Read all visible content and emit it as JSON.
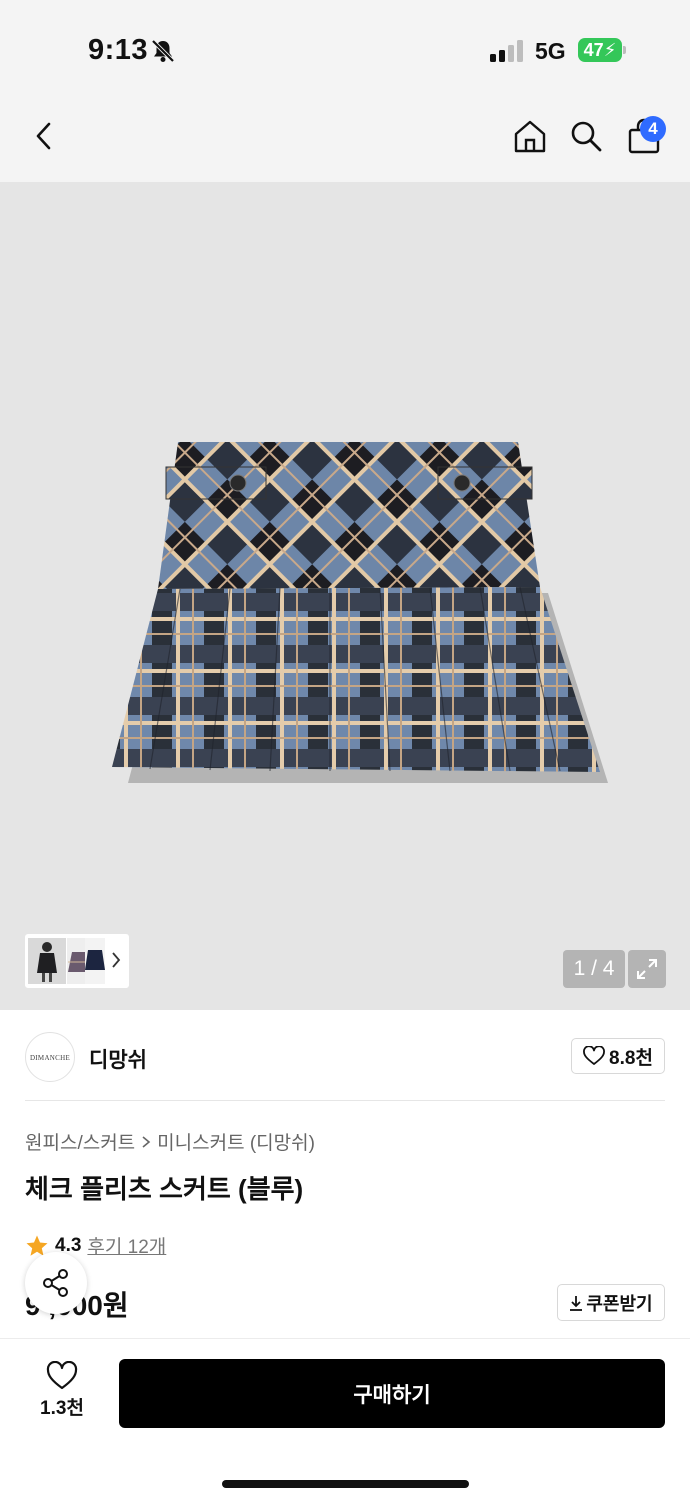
{
  "status_bar": {
    "time": "9:13",
    "network": "5G",
    "battery": "47"
  },
  "header": {
    "cart_count": "4"
  },
  "gallery": {
    "counter": "1 / 4"
  },
  "brand": {
    "logo_text": "DIMANCHE",
    "name": "디망쉬",
    "likes": "8.8천"
  },
  "breadcrumb": {
    "category": "원피스/스커트",
    "subcategory": "미니스커트 (디망쉬)"
  },
  "product": {
    "title": "체크 플리츠 스커트 (블루)",
    "rating": "4.3",
    "reviews": "후기 12개",
    "price": "9 ,000원"
  },
  "coupon": {
    "label": "쿠폰받기"
  },
  "bottom_bar": {
    "wish_count": "1.3천",
    "buy_label": "구매하기"
  },
  "colors": {
    "accent": "#2f6bff",
    "battery": "#34c759",
    "star": "#f5a623",
    "cta": "#000000"
  }
}
